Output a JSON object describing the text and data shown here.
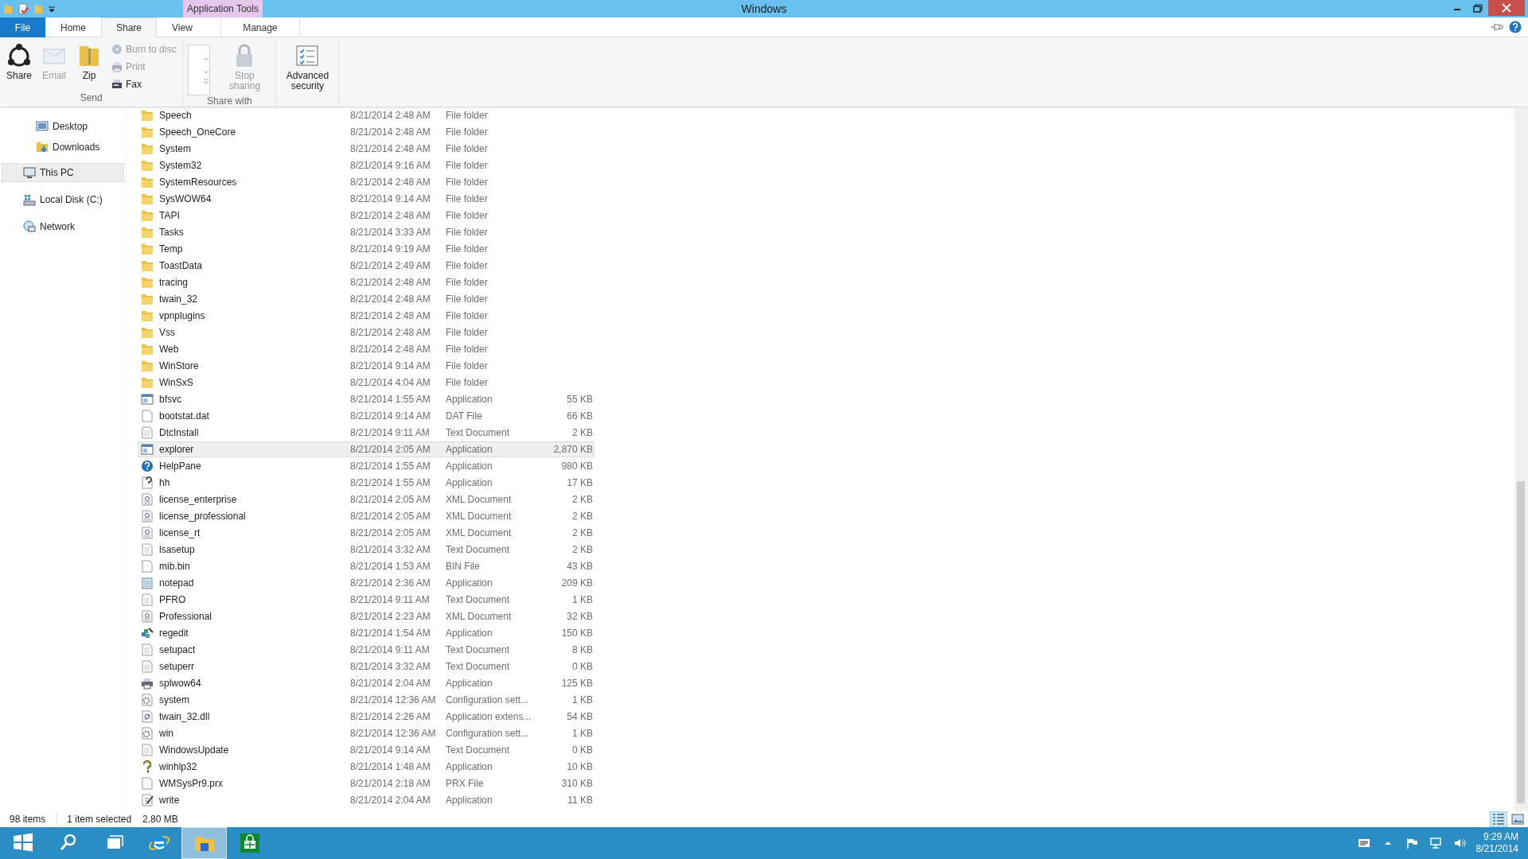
{
  "window": {
    "title": "Windows",
    "context_tab_group": "Application Tools"
  },
  "ribbon_tabs": [
    {
      "label": "File",
      "kind": "file",
      "selected": false
    },
    {
      "label": "Home",
      "kind": "tab",
      "selected": false
    },
    {
      "label": "Share",
      "kind": "tab",
      "selected": true
    },
    {
      "label": "View",
      "kind": "tab",
      "selected": false
    },
    {
      "label": "Manage",
      "kind": "context",
      "selected": false
    }
  ],
  "ribbon_groups": [
    {
      "label": "Send",
      "large": [
        {
          "label": "Share",
          "disabled": false
        },
        {
          "label": "Email",
          "disabled": true
        },
        {
          "label": "Zip",
          "disabled": false
        }
      ],
      "small": [
        {
          "label": "Burn to disc",
          "disabled": true
        },
        {
          "label": "Print",
          "disabled": true
        },
        {
          "label": "Fax",
          "disabled": false
        }
      ]
    },
    {
      "label": "Share with",
      "large": [
        {
          "label": "Stop sharing",
          "disabled": true
        }
      ]
    },
    {
      "large": [
        {
          "label": "Advanced security",
          "disabled": false
        }
      ]
    }
  ],
  "navigation": {
    "favorites": [
      {
        "label": "Desktop",
        "selected": false
      },
      {
        "label": "Downloads",
        "selected": false
      }
    ],
    "locations": [
      {
        "label": "This PC",
        "selected": true
      },
      {
        "label": "Local Disk (C:)",
        "selected": false
      },
      {
        "label": "Network",
        "selected": false
      }
    ]
  },
  "files": [
    {
      "name": "Speech",
      "date": "8/21/2014 2:48 AM",
      "type": "File folder",
      "kind": "folder",
      "selected": false
    },
    {
      "name": "Speech_OneCore",
      "date": "8/21/2014 2:48 AM",
      "type": "File folder",
      "kind": "folder",
      "selected": false
    },
    {
      "name": "System",
      "date": "8/21/2014 2:48 AM",
      "type": "File folder",
      "kind": "folder",
      "selected": false
    },
    {
      "name": "System32",
      "date": "8/21/2014 9:16 AM",
      "type": "File folder",
      "kind": "folder",
      "selected": false
    },
    {
      "name": "SystemResources",
      "date": "8/21/2014 2:48 AM",
      "type": "File folder",
      "kind": "folder",
      "selected": false
    },
    {
      "name": "SysWOW64",
      "date": "8/21/2014 9:14 AM",
      "type": "File folder",
      "kind": "folder",
      "selected": false
    },
    {
      "name": "TAPI",
      "date": "8/21/2014 2:48 AM",
      "type": "File folder",
      "kind": "folder",
      "selected": false
    },
    {
      "name": "Tasks",
      "date": "8/21/2014 3:33 AM",
      "type": "File folder",
      "kind": "folder",
      "selected": false
    },
    {
      "name": "Temp",
      "date": "8/21/2014 9:19 AM",
      "type": "File folder",
      "kind": "folder",
      "selected": false
    },
    {
      "name": "ToastData",
      "date": "8/21/2014 2:49 AM",
      "type": "File folder",
      "kind": "folder",
      "selected": false
    },
    {
      "name": "tracing",
      "date": "8/21/2014 2:48 AM",
      "type": "File folder",
      "kind": "folder",
      "selected": false
    },
    {
      "name": "twain_32",
      "date": "8/21/2014 2:48 AM",
      "type": "File folder",
      "kind": "folder",
      "selected": false
    },
    {
      "name": "vpnplugins",
      "date": "8/21/2014 2:48 AM",
      "type": "File folder",
      "kind": "folder",
      "selected": false
    },
    {
      "name": "Vss",
      "date": "8/21/2014 2:48 AM",
      "type": "File folder",
      "kind": "folder",
      "selected": false
    },
    {
      "name": "Web",
      "date": "8/21/2014 2:48 AM",
      "type": "File folder",
      "kind": "folder",
      "selected": false
    },
    {
      "name": "WinStore",
      "date": "8/21/2014 9:14 AM",
      "type": "File folder",
      "kind": "folder",
      "selected": false
    },
    {
      "name": "WinSxS",
      "date": "8/21/2014 4:04 AM",
      "type": "File folder",
      "kind": "folder",
      "selected": false
    },
    {
      "name": "bfsvc",
      "date": "8/21/2014 1:55 AM",
      "type": "Application",
      "size": "55 KB",
      "kind": "app",
      "selected": false
    },
    {
      "name": "bootstat.dat",
      "date": "8/21/2014 9:14 AM",
      "type": "DAT File",
      "size": "66 KB",
      "kind": "blank",
      "selected": false
    },
    {
      "name": "DtcInstall",
      "date": "8/21/2014 9:11 AM",
      "type": "Text Document",
      "size": "2 KB",
      "kind": "text",
      "selected": false
    },
    {
      "name": "explorer",
      "date": "8/21/2014 2:05 AM",
      "type": "Application",
      "size": "2,870 KB",
      "kind": "app",
      "selected": true
    },
    {
      "name": "HelpPane",
      "date": "8/21/2014 1:55 AM",
      "type": "Application",
      "size": "980 KB",
      "kind": "help",
      "selected": false
    },
    {
      "name": "hh",
      "date": "8/21/2014 1:55 AM",
      "type": "Application",
      "size": "17 KB",
      "kind": "helpdoc",
      "selected": false
    },
    {
      "name": "license_enterprise",
      "date": "8/21/2014 2:05 AM",
      "type": "XML Document",
      "size": "2 KB",
      "kind": "xml",
      "selected": false
    },
    {
      "name": "license_professional",
      "date": "8/21/2014 2:05 AM",
      "type": "XML Document",
      "size": "2 KB",
      "kind": "xml",
      "selected": false
    },
    {
      "name": "license_rt",
      "date": "8/21/2014 2:05 AM",
      "type": "XML Document",
      "size": "2 KB",
      "kind": "xml",
      "selected": false
    },
    {
      "name": "lsasetup",
      "date": "8/21/2014 3:32 AM",
      "type": "Text Document",
      "size": "2 KB",
      "kind": "text",
      "selected": false
    },
    {
      "name": "mib.bin",
      "date": "8/21/2014 1:53 AM",
      "type": "BIN File",
      "size": "43 KB",
      "kind": "blank",
      "selected": false
    },
    {
      "name": "notepad",
      "date": "8/21/2014 2:36 AM",
      "type": "Application",
      "size": "209 KB",
      "kind": "notepad",
      "selected": false
    },
    {
      "name": "PFRO",
      "date": "8/21/2014 9:11 AM",
      "type": "Text Document",
      "size": "1 KB",
      "kind": "text",
      "selected": false
    },
    {
      "name": "Professional",
      "date": "8/21/2014 2:23 AM",
      "type": "XML Document",
      "size": "32 KB",
      "kind": "xml",
      "selected": false
    },
    {
      "name": "regedit",
      "date": "8/21/2014 1:54 AM",
      "type": "Application",
      "size": "150 KB",
      "kind": "registry",
      "selected": false
    },
    {
      "name": "setupact",
      "date": "8/21/2014 9:11 AM",
      "type": "Text Document",
      "size": "8 KB",
      "kind": "text",
      "selected": false
    },
    {
      "name": "setuperr",
      "date": "8/21/2014 3:32 AM",
      "type": "Text Document",
      "size": "0 KB",
      "kind": "text",
      "selected": false
    },
    {
      "name": "splwow64",
      "date": "8/21/2014 2:04 AM",
      "type": "Application",
      "size": "125 KB",
      "kind": "printer",
      "selected": false
    },
    {
      "name": "system",
      "date": "8/21/2014 12:36 AM",
      "type": "Configuration sett...",
      "size": "1 KB",
      "kind": "config",
      "selected": false
    },
    {
      "name": "twain_32.dll",
      "date": "8/21/2014 2:26 AM",
      "type": "Application extens...",
      "size": "54 KB",
      "kind": "dll",
      "selected": false
    },
    {
      "name": "win",
      "date": "8/21/2014 12:36 AM",
      "type": "Configuration sett...",
      "size": "1 KB",
      "kind": "config",
      "selected": false
    },
    {
      "name": "WindowsUpdate",
      "date": "8/21/2014 9:14 AM",
      "type": "Text Document",
      "size": "0 KB",
      "kind": "text",
      "selected": false
    },
    {
      "name": "winhlp32",
      "date": "8/21/2014 1:48 AM",
      "type": "Application",
      "size": "10 KB",
      "kind": "question",
      "selected": false
    },
    {
      "name": "WMSysPr9.prx",
      "date": "8/21/2014 2:18 AM",
      "type": "PRX File",
      "size": "310 KB",
      "kind": "blank",
      "selected": false
    },
    {
      "name": "write",
      "date": "8/21/2014 2:04 AM",
      "type": "Application",
      "size": "11 KB",
      "kind": "write",
      "selected": false
    }
  ],
  "status_bar": {
    "item_count": "98 items",
    "selection": "1 item selected",
    "selection_size": "2.80 MB",
    "views": [
      {
        "selected": true
      },
      {
        "selected": false
      }
    ]
  },
  "taskbar": {
    "apps": [
      {
        "active": false
      },
      {
        "active": false
      },
      {
        "active": false
      },
      {
        "active": false
      },
      {
        "active": true
      },
      {
        "active": false
      }
    ],
    "time": "9:29 AM",
    "date": "8/21/2014"
  }
}
